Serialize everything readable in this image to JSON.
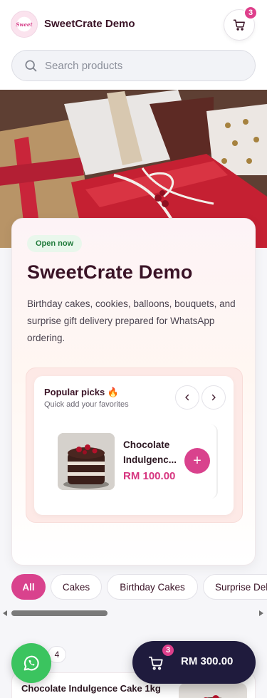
{
  "header": {
    "logo_text": "Sweet",
    "brand": "SweetCrate Demo",
    "cart_count": "3"
  },
  "search": {
    "placeholder": "Search products"
  },
  "hero": {
    "image": "wrapped-gifts-photo"
  },
  "store": {
    "status": "Open now",
    "title": "SweetCrate Demo",
    "description": "Birthday cakes, cookies, balloons, bouquets, and surprise gift delivery prepared for WhatsApp ordering."
  },
  "popular": {
    "title": "Popular picks 🔥",
    "subtitle": "Quick add your favorites",
    "product": {
      "name": "Chocolate Indulgenc...",
      "price": "RM 100.00",
      "image": "chocolate-cake-photo"
    }
  },
  "categories": [
    {
      "label": "All",
      "active": true
    },
    {
      "label": "Cakes",
      "active": false
    },
    {
      "label": "Birthday Cakes",
      "active": false
    },
    {
      "label": "Surprise Del",
      "active": false
    }
  ],
  "section": {
    "count": "4",
    "first_item": "Chocolate Indulgence Cake 1kg"
  },
  "floating_cart": {
    "count": "3",
    "total": "RM 300.00"
  },
  "colors": {
    "accent": "#d9428d",
    "dark": "#1f1b3d",
    "whatsapp": "#3bc45f",
    "open": "#1f7a3a"
  }
}
